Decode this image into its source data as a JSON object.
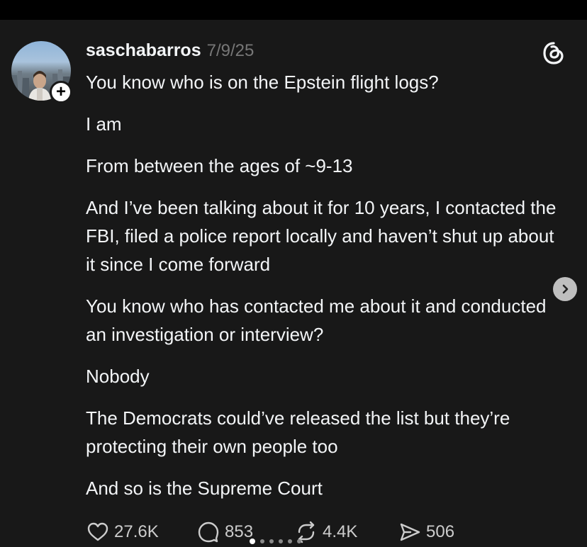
{
  "post": {
    "username": "saschabarros",
    "timestamp": "7/9/25",
    "paragraphs": [
      "You know who is on the Epstein flight logs?",
      "I am",
      "From between the ages of ~9-13",
      "And I’ve been talking about it for 10 years, I contacted the FBI, filed a police report locally and haven’t shut up about it since I come forward",
      "You know who has contacted me about it and conducted an investigation or interview?",
      "Nobody",
      "The Democrats could’ve released the list but they’re protecting their own people too",
      "And so is the Supreme Court"
    ]
  },
  "actions": {
    "likes": "27.6K",
    "replies": "853",
    "reposts": "4.4K",
    "shares": "506"
  },
  "icons": {
    "avatar_add": "plus-icon",
    "brand": "threads-logo-icon",
    "next": "chevron-right-icon",
    "like": "heart-icon",
    "reply": "comment-icon",
    "repost": "repost-icon",
    "share": "send-icon"
  },
  "carousel": {
    "total": 6,
    "active_index": 0
  },
  "colors": {
    "background": "#181818",
    "text": "#f3f5f7",
    "muted": "#777777"
  }
}
